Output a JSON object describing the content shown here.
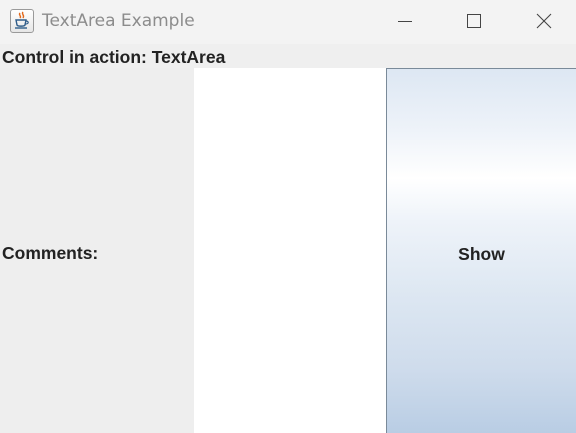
{
  "window": {
    "title": "TextArea Example",
    "icon": "java-coffee-cup-icon",
    "controls": [
      "minimize-icon",
      "maximize-icon",
      "close-icon"
    ]
  },
  "header": {
    "text": "Control in action: TextArea"
  },
  "form": {
    "comments_label": "Comments:",
    "comments_value": "",
    "show_button_label": "Show"
  },
  "colors": {
    "titlebar_bg": "#f3f3f3",
    "content_bg": "#eeeeee",
    "textarea_bg": "#ffffff",
    "button_gradient_top": "#dde7f3",
    "button_gradient_bottom": "#b9cde4"
  }
}
